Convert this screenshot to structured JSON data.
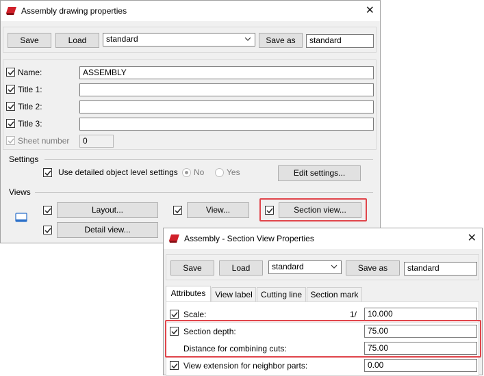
{
  "main_dialog": {
    "title": "Assembly drawing properties",
    "toolbar": {
      "save_label": "Save",
      "load_label": "Load",
      "preset_value": "standard",
      "save_as_label": "Save as",
      "save_as_value": "standard"
    },
    "fields": [
      {
        "label": "Name:",
        "value": "ASSEMBLY",
        "checked": true
      },
      {
        "label": "Title 1:",
        "value": "",
        "checked": true
      },
      {
        "label": "Title 2:",
        "value": "",
        "checked": true
      },
      {
        "label": "Title 3:",
        "value": "",
        "checked": true
      }
    ],
    "sheet_number": {
      "label": "Sheet number",
      "value": "0",
      "checked": true,
      "disabled": true
    },
    "settings": {
      "group_label": "Settings",
      "detailed_label": "Use detailed object level settings",
      "no_label": "No",
      "yes_label": "Yes",
      "edit_label": "Edit settings..."
    },
    "views": {
      "group_label": "Views",
      "layout_label": "Layout...",
      "view_label": "View...",
      "section_view_label": "Section view...",
      "detail_view_label": "Detail view..."
    }
  },
  "section_dialog": {
    "title": "Assembly - Section View Properties",
    "toolbar": {
      "save_label": "Save",
      "load_label": "Load",
      "preset_value": "standard",
      "save_as_label": "Save as",
      "save_as_value": "standard"
    },
    "tabs": [
      "Attributes",
      "View label",
      "Cutting line",
      "Section mark"
    ],
    "scale": {
      "label": "Scale:",
      "prefix": "1/",
      "value": "10.000"
    },
    "section_depth": {
      "label": "Section depth:",
      "value": "75.00"
    },
    "combining": {
      "label": "Distance for combining cuts:",
      "value": "75.00"
    },
    "view_extension": {
      "label": "View extension for neighbor parts:",
      "value": "0.00"
    }
  },
  "colors": {
    "highlight": "#e0444a",
    "app_icon": "#d0202a"
  }
}
